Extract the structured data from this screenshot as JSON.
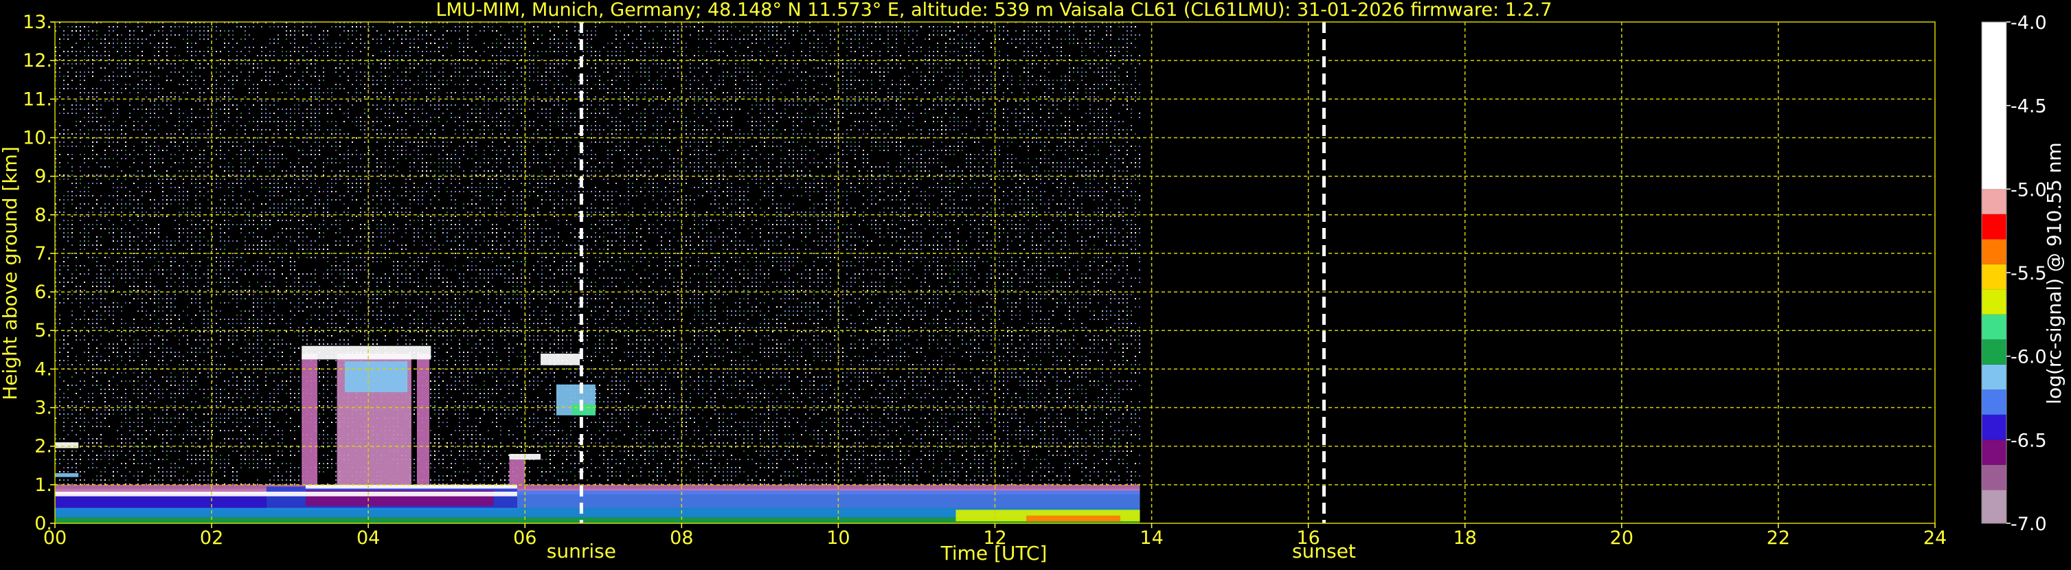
{
  "chart_data": {
    "type": "heatmap",
    "title": "LMU-MIM, Munich, Germany; 48.148° N 11.573° E, altitude: 539 m    Vaisala CL61 (CL61LMU): 31-01-2026    firmware: 1.2.7",
    "xlabel": "Time [UTC]",
    "ylabel": "Height above ground [km]",
    "colorbar_label": "log(rc-signal) @ 910.55 nm",
    "xlim": [
      0,
      24
    ],
    "ylim": [
      0,
      13
    ],
    "clim": [
      -7.0,
      -4.0
    ],
    "x_ticks": [
      0,
      2,
      4,
      6,
      8,
      10,
      12,
      14,
      16,
      18,
      20,
      22,
      24
    ],
    "x_tick_labels": [
      "00",
      "02",
      "04",
      "06",
      "08",
      "10",
      "12",
      "14",
      "16",
      "18",
      "20",
      "22",
      "24"
    ],
    "y_ticks": [
      0,
      1,
      2,
      3,
      4,
      5,
      6,
      7,
      8,
      9,
      10,
      11,
      12,
      13
    ],
    "y_tick_labels": [
      "0.",
      "1.",
      "2.",
      "3.",
      "4.",
      "5.",
      "6.",
      "7.",
      "8.",
      "9.",
      "10.",
      "11.",
      "12.",
      "13."
    ],
    "colorbar_ticks": [
      -4.0,
      -4.5,
      -5.0,
      -5.5,
      -6.0,
      -6.5,
      -7.0
    ],
    "colorbar_tick_labels": [
      "-4.0",
      "-4.5",
      "-5.0",
      "-5.5",
      "-6.0",
      "-6.5",
      "-7.0"
    ],
    "grid": true,
    "grid_color": "#d4d400",
    "data_end_time": 13.85,
    "sunrise": 6.72,
    "sunset": 16.2,
    "annotations": {
      "sunrise_label": "sunrise",
      "sunset_label": "sunset"
    },
    "colormap": [
      {
        "v": -7.0,
        "color": "#b89bb4"
      },
      {
        "v": -6.8,
        "color": "#9b5e94"
      },
      {
        "v": -6.65,
        "color": "#7d0c7d"
      },
      {
        "v": -6.5,
        "color": "#3018d6"
      },
      {
        "v": -6.35,
        "color": "#4a7cf0"
      },
      {
        "v": -6.2,
        "color": "#7fc4f0"
      },
      {
        "v": -6.05,
        "color": "#19a34a"
      },
      {
        "v": -5.9,
        "color": "#3fe08a"
      },
      {
        "v": -5.75,
        "color": "#d8f000"
      },
      {
        "v": -5.6,
        "color": "#ffd200"
      },
      {
        "v": -5.45,
        "color": "#ff7a00"
      },
      {
        "v": -5.3,
        "color": "#ff0000"
      },
      {
        "v": -5.15,
        "color": "#f0a8a8"
      },
      {
        "v": -5.0,
        "color": "#ffffff"
      },
      {
        "v": -4.0,
        "color": "#ffffff"
      }
    ],
    "features": [
      {
        "kind": "noise",
        "t0": 0.0,
        "t1": 13.85,
        "h0": 1.0,
        "h1": 13.0,
        "density": 0.55,
        "colors": [
          "#6a5aa6",
          "#8a79c4",
          "#a59bd6",
          "#c9c2e8",
          "#ffffff",
          "#5a9fd0",
          "#2d7a40"
        ]
      },
      {
        "kind": "band",
        "t0": 0.0,
        "t1": 13.85,
        "h0": 0.9,
        "h1": 1.0,
        "color": "#c06ab0"
      },
      {
        "kind": "band",
        "t0": 0.0,
        "t1": 13.85,
        "h0": 0.75,
        "h1": 0.9,
        "color": "#d07fc0"
      },
      {
        "kind": "band",
        "t0": 0.0,
        "t1": 2.7,
        "h0": 0.35,
        "h1": 0.75,
        "color": "#3018d6"
      },
      {
        "kind": "band",
        "t0": 2.7,
        "t1": 5.9,
        "h0": 0.35,
        "h1": 0.95,
        "color": "#2b3fd8"
      },
      {
        "kind": "band",
        "t0": 5.9,
        "t1": 13.85,
        "h0": 0.4,
        "h1": 0.85,
        "color": "#4a7cf0"
      },
      {
        "kind": "band",
        "t0": 0.0,
        "t1": 13.85,
        "h0": 0.15,
        "h1": 0.4,
        "color": "#1c8fe0"
      },
      {
        "kind": "band",
        "t0": 0.0,
        "t1": 13.85,
        "h0": 0.0,
        "h1": 0.15,
        "color": "#19a34a"
      },
      {
        "kind": "band",
        "t0": 3.2,
        "t1": 5.6,
        "h0": 0.45,
        "h1": 0.85,
        "color": "#7d0c7d"
      },
      {
        "kind": "band",
        "t0": 11.5,
        "t1": 13.85,
        "h0": 0.05,
        "h1": 0.35,
        "color": "#d8f000"
      },
      {
        "kind": "band",
        "t0": 12.4,
        "t1": 13.6,
        "h0": 0.05,
        "h1": 0.2,
        "color": "#ff7a00"
      },
      {
        "kind": "band",
        "t0": 0.0,
        "t1": 5.9,
        "h0": 0.7,
        "h1": 0.82,
        "color": "#ffffff"
      },
      {
        "kind": "band",
        "t0": 3.2,
        "t1": 5.9,
        "h0": 0.9,
        "h1": 1.0,
        "color": "#ffffff"
      },
      {
        "kind": "band",
        "t0": 3.15,
        "t1": 3.35,
        "h0": 1.0,
        "h1": 4.4,
        "color": "#c06ab0"
      },
      {
        "kind": "band",
        "t0": 3.6,
        "t1": 4.55,
        "h0": 1.0,
        "h1": 4.4,
        "color": "#c986bd"
      },
      {
        "kind": "band",
        "t0": 4.62,
        "t1": 4.78,
        "h0": 1.0,
        "h1": 4.4,
        "color": "#c06ab0"
      },
      {
        "kind": "band",
        "t0": 3.15,
        "t1": 4.8,
        "h0": 4.25,
        "h1": 4.6,
        "color": "#ffffff"
      },
      {
        "kind": "band",
        "t0": 3.7,
        "t1": 4.5,
        "h0": 3.4,
        "h1": 4.2,
        "color": "#7fc4f0"
      },
      {
        "kind": "band",
        "t0": 6.2,
        "t1": 6.7,
        "h0": 4.1,
        "h1": 4.4,
        "color": "#ffffff"
      },
      {
        "kind": "band",
        "t0": 6.4,
        "t1": 6.9,
        "h0": 2.8,
        "h1": 3.6,
        "color": "#7fc4f0"
      },
      {
        "kind": "band",
        "t0": 6.6,
        "t1": 6.9,
        "h0": 2.8,
        "h1": 3.1,
        "color": "#3fe08a"
      },
      {
        "kind": "band",
        "t0": 5.8,
        "t1": 6.2,
        "h0": 1.65,
        "h1": 1.8,
        "color": "#ffffff"
      },
      {
        "kind": "band",
        "t0": 0.0,
        "t1": 0.3,
        "h0": 1.95,
        "h1": 2.1,
        "color": "#ffffff"
      },
      {
        "kind": "band",
        "t0": 0.0,
        "t1": 0.3,
        "h0": 1.2,
        "h1": 1.3,
        "color": "#7fc4f0"
      },
      {
        "kind": "band",
        "t0": 5.8,
        "t1": 6.0,
        "h0": 1.0,
        "h1": 1.65,
        "color": "#c06ab0"
      }
    ]
  }
}
